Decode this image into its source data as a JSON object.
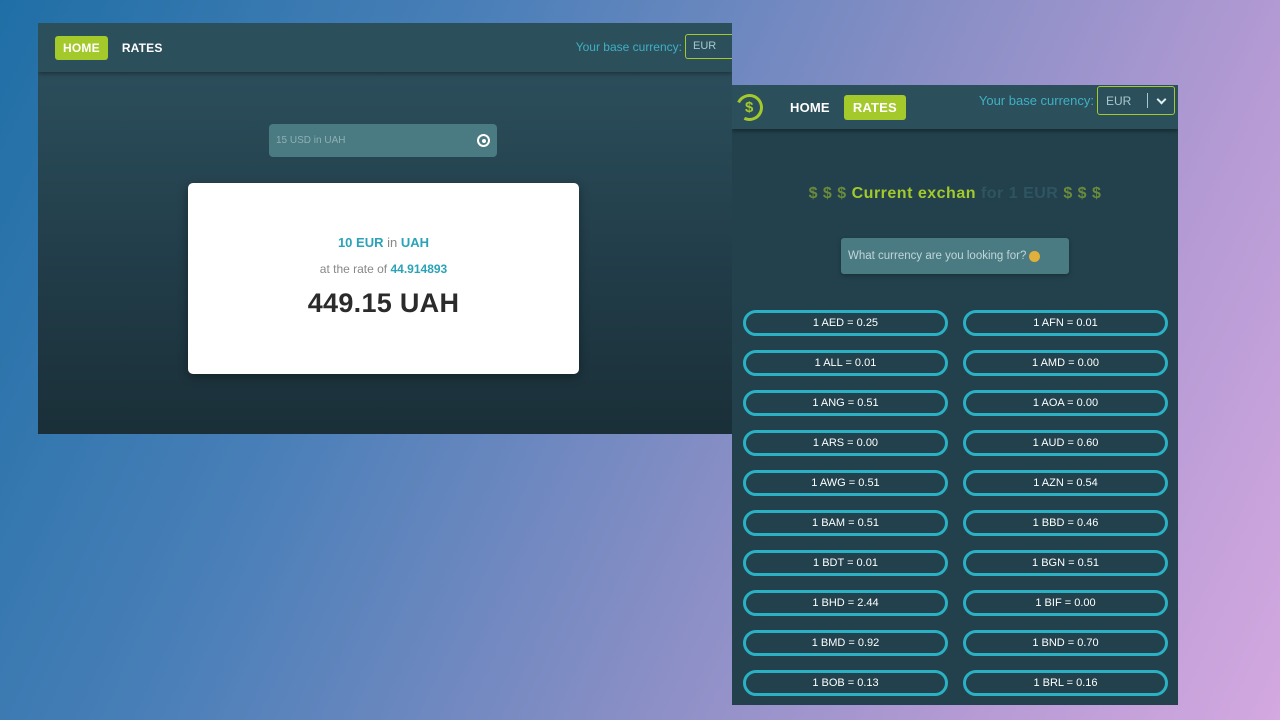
{
  "home_window": {
    "nav": {
      "home_label": "HOME",
      "rates_label": "RATES"
    },
    "base_currency_label": "Your base currency:",
    "base_currency_value": "EUR",
    "search_placeholder": "15 USD in UAH",
    "result": {
      "amount_currency": "10 EUR",
      "in_word": "in",
      "target_currency": "UAH",
      "rate_prefix": "at the rate of",
      "rate_value": "44.914893",
      "total": "449.15 UAH"
    }
  },
  "rates_window": {
    "nav": {
      "home_label": "HOME",
      "rates_label": "RATES",
      "logo_glyph": "$"
    },
    "base_currency_label": "Your base currency:",
    "base_currency_value": "EUR",
    "title": {
      "prefix": "$ $ $",
      "main": "Current  exchan",
      "ghost": "for 1  EUR",
      "suffix": "$ $ $"
    },
    "search_placeholder": "What currency are you looking for?",
    "rates": [
      "1 AED = 0.25",
      "1 AFN = 0.01",
      "1 ALL = 0.01",
      "1 AMD = 0.00",
      "1 ANG = 0.51",
      "1 AOA = 0.00",
      "1 ARS = 0.00",
      "1 AUD = 0.60",
      "1 AWG = 0.51",
      "1 AZN = 0.54",
      "1 BAM = 0.51",
      "1 BBD = 0.46",
      "1 BDT = 0.01",
      "1 BGN = 0.51",
      "1 BHD = 2.44",
      "1 BIF = 0.00",
      "1 BMD = 0.92",
      "1 BND = 0.70",
      "1 BOB = 0.13",
      "1 BRL = 0.16"
    ]
  },
  "colors": {
    "accent_green": "#a3c92b",
    "accent_teal": "#2ab2c4",
    "nav_bg": "#2c4f5c"
  }
}
